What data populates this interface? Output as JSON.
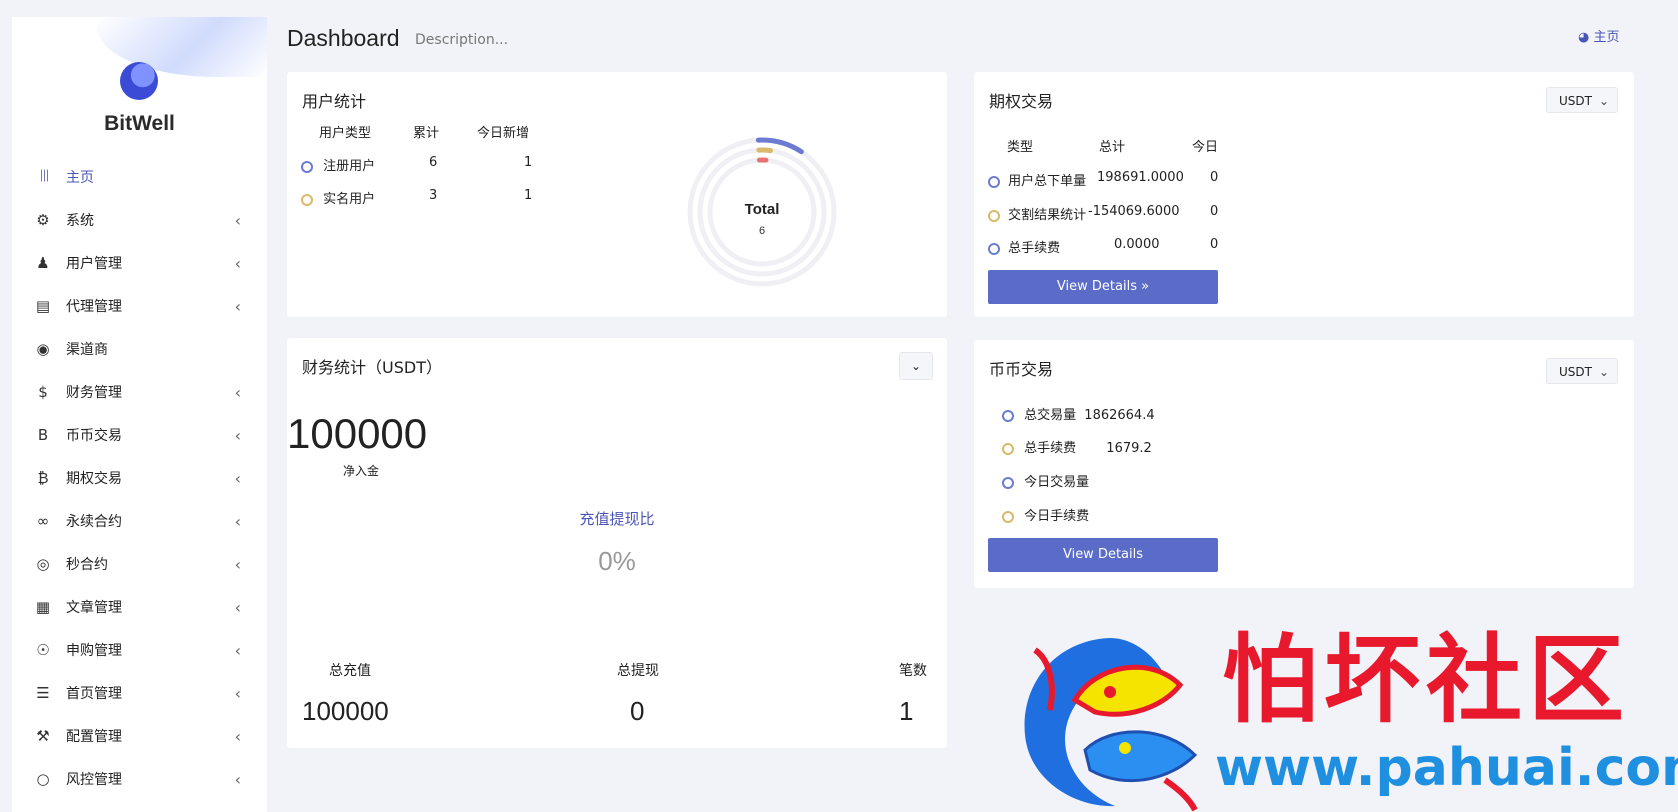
{
  "brand": {
    "name": "BitWell"
  },
  "sidebar": {
    "items": [
      {
        "label": "主页",
        "icon": "bar-chart-icon",
        "glyph": "│││",
        "active": true,
        "has_children": false
      },
      {
        "label": "系统",
        "icon": "gear-icon",
        "glyph": "⚙",
        "has_children": true
      },
      {
        "label": "用户管理",
        "icon": "users-icon",
        "glyph": "♟",
        "has_children": true
      },
      {
        "label": "代理管理",
        "icon": "id-card-icon",
        "glyph": "▤",
        "has_children": true
      },
      {
        "label": "渠道商",
        "icon": "user-circle-icon",
        "glyph": "◉",
        "has_children": false
      },
      {
        "label": "财务管理",
        "icon": "dollar-icon",
        "glyph": "$",
        "has_children": true
      },
      {
        "label": "币币交易",
        "icon": "bitcoin-b-icon",
        "glyph": "B",
        "has_children": true
      },
      {
        "label": "期权交易",
        "icon": "bitcoin-icon",
        "glyph": "₿",
        "has_children": true
      },
      {
        "label": "永续合约",
        "icon": "link-icon",
        "glyph": "∞",
        "has_children": true
      },
      {
        "label": "秒合约",
        "icon": "target-icon",
        "glyph": "◎",
        "has_children": true
      },
      {
        "label": "文章管理",
        "icon": "newspaper-icon",
        "glyph": "▦",
        "has_children": true
      },
      {
        "label": "申购管理",
        "icon": "lifebuoy-icon",
        "glyph": "☉",
        "has_children": true
      },
      {
        "label": "首页管理",
        "icon": "list-icon",
        "glyph": "☰",
        "has_children": true
      },
      {
        "label": "配置管理",
        "icon": "wrench-icon",
        "glyph": "⚒",
        "has_children": true
      },
      {
        "label": "风控管理",
        "icon": "circle-icon",
        "glyph": "○",
        "has_children": true
      }
    ]
  },
  "header": {
    "title": "Dashboard",
    "description": "Description...",
    "home_label": "主页"
  },
  "user_stats": {
    "title": "用户统计",
    "columns": [
      "用户类型",
      "累计",
      "今日新增"
    ],
    "rows": [
      {
        "name": "注册用户",
        "total": "6",
        "today": "1"
      },
      {
        "name": "实名用户",
        "total": "3",
        "today": "1"
      }
    ],
    "donut": {
      "label": "Total",
      "value": "6",
      "fractions": [
        0.1,
        0.03,
        0.02
      ]
    }
  },
  "options_trading": {
    "title": "期权交易",
    "currency": "USDT",
    "columns": [
      "类型",
      "总计",
      "今日"
    ],
    "rows": [
      {
        "name": "用户总下单量",
        "total": "198691.0000",
        "today": "0"
      },
      {
        "name": "交割结果统计",
        "total": "-154069.6000",
        "today": "0"
      },
      {
        "name": "总手续费",
        "total": "0.0000",
        "today": "0"
      }
    ],
    "button_label": "View Details »"
  },
  "finance": {
    "title": "财务统计（USDT）",
    "net_deposit_value": "100000",
    "net_deposit_label": "净入金",
    "ratio_label": "充值提现比",
    "ratio_value": "0%",
    "stats": [
      {
        "label": "总充值",
        "value": "100000"
      },
      {
        "label": "总提现",
        "value": "0"
      },
      {
        "label": "笔数",
        "value": "1"
      }
    ]
  },
  "spot_trading": {
    "title": "币币交易",
    "currency": "USDT",
    "rows": [
      {
        "name": "总交易量",
        "value": "1862664.4"
      },
      {
        "name": "总手续费",
        "value": "1679.2"
      },
      {
        "name": "今日交易量",
        "value": ""
      },
      {
        "name": "今日手续费",
        "value": ""
      }
    ],
    "button_label": "View Details"
  },
  "watermark": {
    "chinese": "怕坏社区",
    "url": "www.pahuai.com"
  },
  "colors": {
    "accent": "#5a6bc8",
    "dot_blue": "#6b7bd1",
    "dot_yellow": "#d9b96b",
    "donut_red": "#e57373"
  }
}
